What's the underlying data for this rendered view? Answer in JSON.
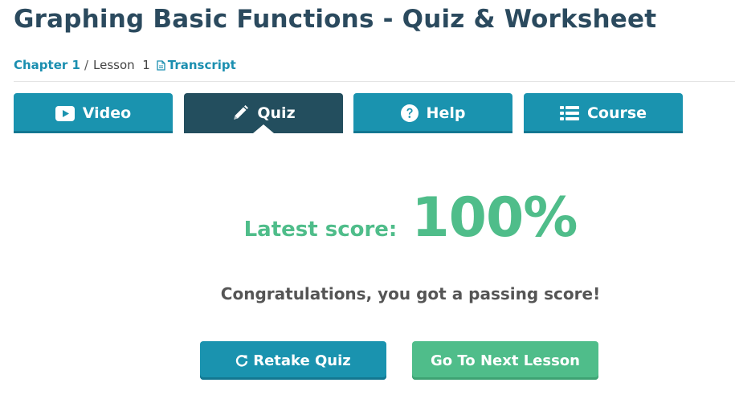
{
  "header": {
    "title": "Graphing Basic Functions - Quiz & Worksheet"
  },
  "breadcrumb": {
    "chapter": "Chapter 1",
    "separator": "/",
    "lesson": "Lesson  1",
    "transcript": "Transcript"
  },
  "tabs": [
    {
      "label": "Video",
      "icon": "play-icon"
    },
    {
      "label": "Quiz",
      "icon": "pencil-icon",
      "active": true
    },
    {
      "label": "Help",
      "icon": "question-circle-icon"
    },
    {
      "label": "Course",
      "icon": "list-icon"
    }
  ],
  "result": {
    "score_label": "Latest score:",
    "score_value": "100%",
    "message": "Congratulations, you got a passing score!"
  },
  "actions": {
    "retake_label": "Retake Quiz",
    "next_label": "Go To Next Lesson"
  },
  "colors": {
    "title": "#2b4a5e",
    "tab": "#1a93af",
    "tab_active": "#234e5e",
    "score_green": "#4fbd8a",
    "link": "#1b8fb0"
  }
}
